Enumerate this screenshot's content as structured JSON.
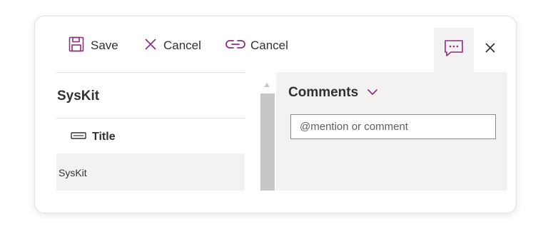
{
  "toolbar": {
    "save_label": "Save",
    "cancel_label": "Cancel",
    "cancel_link_label": "Cancel"
  },
  "form": {
    "site_title": "SysKit",
    "field_label": "Title",
    "field_value": "SysKit"
  },
  "comments": {
    "title": "Comments",
    "input_placeholder": "@mention or comment"
  },
  "colors": {
    "accent": "#8a2f7f",
    "text": "#323130",
    "pane_bg": "#f3f2f1",
    "scroll_track": "#c8c6c4"
  },
  "icons": {
    "save": "save-icon",
    "cancel": "close-x-icon",
    "link": "link-icon",
    "comment": "comment-icon",
    "close": "close-icon",
    "chevron": "chevron-down-icon",
    "text_field": "text-field-icon",
    "scroll_up": "scroll-up-arrow-icon"
  }
}
